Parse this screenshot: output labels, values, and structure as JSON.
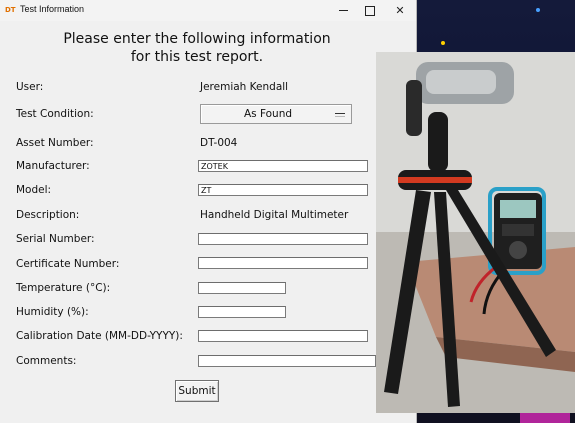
{
  "window": {
    "icon_text": "DT",
    "title": "Test Information",
    "controls": {
      "minimize": "",
      "maximize": "",
      "close": "✕"
    }
  },
  "heading": {
    "line1": "Please enter the following information",
    "line2": "for this test report."
  },
  "form": {
    "user": {
      "label": "User:",
      "value": "Jeremiah Kendall"
    },
    "test_condition": {
      "label": "Test Condition:",
      "value": "As Found"
    },
    "asset_number": {
      "label": "Asset Number:",
      "value": "DT-004"
    },
    "manufacturer": {
      "label": "Manufacturer:",
      "value": "ZOTEK"
    },
    "model": {
      "label": "Model:",
      "value": "ZT"
    },
    "description": {
      "label": "Description:",
      "value": "Handheld Digital Multimeter"
    },
    "serial_number": {
      "label": "Serial Number:",
      "value": ""
    },
    "certificate_number": {
      "label": "Certificate Number:",
      "value": ""
    },
    "temperature": {
      "label": "Temperature (°C):",
      "value": ""
    },
    "humidity": {
      "label": "Humidity (%):",
      "value": ""
    },
    "calibration_date": {
      "label": "Calibration Date (MM-DD-YYYY):",
      "value": ""
    },
    "comments": {
      "label": "Comments:",
      "value": ""
    }
  },
  "submit_label": "Submit",
  "colors": {
    "window_bg": "#f0f0f0",
    "desktop_bg": "#0b1030",
    "tripod_body": "#1a1a1a",
    "tripod_accent": "#d33a20",
    "multimeter_accent": "#2aa0c8"
  }
}
